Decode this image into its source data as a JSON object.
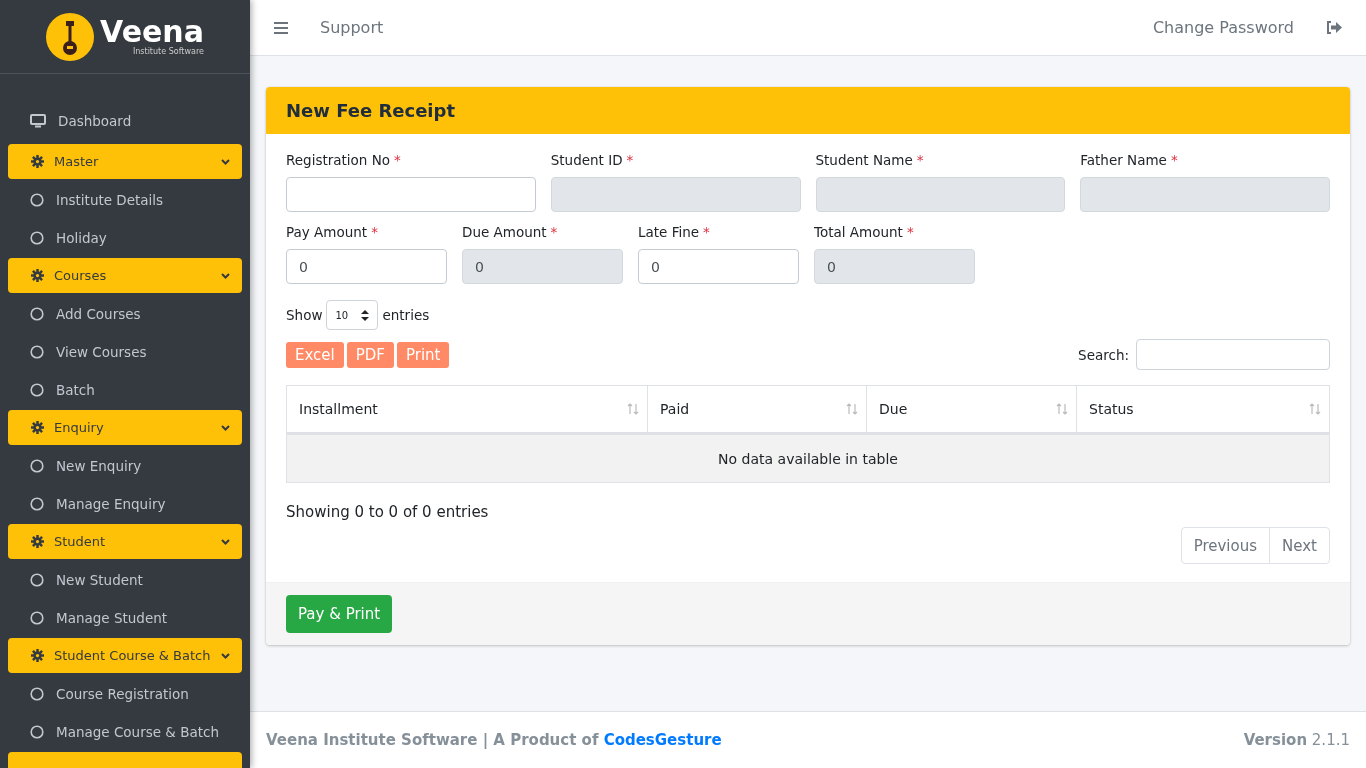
{
  "brand": {
    "name": "Veena",
    "tagline": "Institute Software"
  },
  "sidebar": {
    "items": [
      {
        "kind": "dashboard",
        "label": "Dashboard"
      },
      {
        "kind": "group",
        "label": "Master",
        "expanded": true
      },
      {
        "kind": "link",
        "label": "Institute Details"
      },
      {
        "kind": "link",
        "label": "Holiday"
      },
      {
        "kind": "group",
        "label": "Courses",
        "expanded": true
      },
      {
        "kind": "link",
        "label": "Add Courses"
      },
      {
        "kind": "link",
        "label": "View Courses"
      },
      {
        "kind": "link",
        "label": "Batch"
      },
      {
        "kind": "group",
        "label": "Enquiry",
        "expanded": true
      },
      {
        "kind": "link",
        "label": "New Enquiry"
      },
      {
        "kind": "link",
        "label": "Manage Enquiry"
      },
      {
        "kind": "group",
        "label": "Student",
        "expanded": true
      },
      {
        "kind": "link",
        "label": "New Student"
      },
      {
        "kind": "link",
        "label": "Manage Student"
      },
      {
        "kind": "group",
        "label": "Student Course & Batch",
        "expanded": true
      },
      {
        "kind": "link",
        "label": "Course Registration"
      },
      {
        "kind": "link",
        "label": "Manage Course & Batch"
      }
    ]
  },
  "topbar": {
    "links": [
      "Support"
    ],
    "right_link": "Change Password"
  },
  "card": {
    "title": "New Fee Receipt",
    "row1": [
      {
        "label": "Registration No",
        "mark": "*",
        "disabled": false
      },
      {
        "label": "Student ID",
        "mark": "*",
        "disabled": true
      },
      {
        "label": "Student Name",
        "mark": "*",
        "disabled": true
      },
      {
        "label": "Father Name",
        "mark": "*",
        "disabled": true
      }
    ],
    "row2": [
      {
        "label": "Pay Amount",
        "mark": "*",
        "value": "0",
        "disabled": false
      },
      {
        "label": "Due Amount",
        "mark": "*",
        "value": "0",
        "disabled": true
      },
      {
        "label": "Late Fine",
        "mark": "*",
        "value": "0",
        "disabled": false
      },
      {
        "label": "Total Amount",
        "mark": "*",
        "value": "0",
        "disabled": true
      }
    ],
    "length": {
      "before": "Show",
      "value": "10",
      "after": "entries"
    },
    "export_buttons": [
      "Excel",
      "PDF",
      "Print"
    ],
    "search_label": "Search:",
    "table": {
      "columns": [
        "Installment",
        "Paid",
        "Due",
        "Status"
      ],
      "empty": "No data available in table"
    },
    "info": "Showing 0 to 0 of 0 entries",
    "pagination": [
      {
        "label": "Previous",
        "disabled": true
      },
      {
        "label": "Next",
        "disabled": true
      }
    ],
    "submit": "Pay & Print"
  },
  "footer": {
    "text": "Veena Institute Software | A Product of ",
    "link": "CodesGesture",
    "version_label": "Version",
    "version": "2.1.1"
  }
}
